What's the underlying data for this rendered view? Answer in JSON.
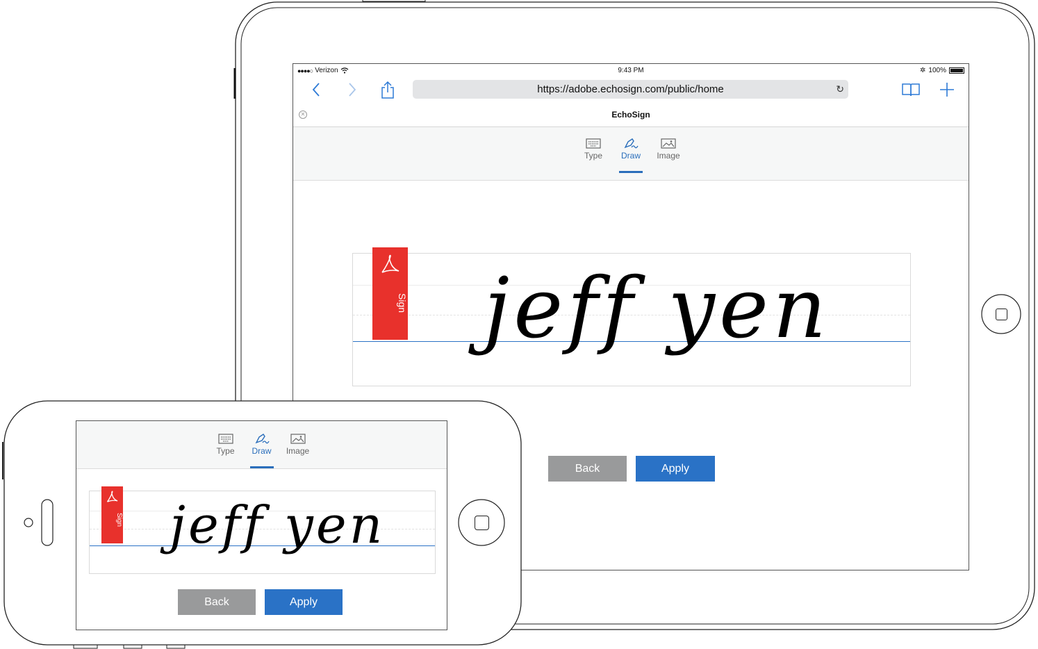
{
  "ipad": {
    "status": {
      "carrier": "Verizon",
      "time": "9:43 PM",
      "battery": "100%"
    },
    "browser": {
      "url": "https://adobe.echosign.com/public/home",
      "tab_title": "EchoSign"
    },
    "modes": [
      {
        "label": "Type",
        "icon": "keyboard-icon"
      },
      {
        "label": "Draw",
        "icon": "pen-icon",
        "active": true
      },
      {
        "label": "Image",
        "icon": "image-icon"
      }
    ],
    "signature": {
      "text": "jeff yen",
      "bookmark_label": "Sign"
    },
    "buttons": {
      "back": "Back",
      "apply": "Apply"
    }
  },
  "iphone": {
    "modes": [
      {
        "label": "Type",
        "icon": "keyboard-icon"
      },
      {
        "label": "Draw",
        "icon": "pen-icon",
        "active": true
      },
      {
        "label": "Image",
        "icon": "image-icon"
      }
    ],
    "signature": {
      "text": "jeff yen",
      "bookmark_label": "Sign"
    },
    "buttons": {
      "back": "Back",
      "apply": "Apply"
    }
  },
  "colors": {
    "accent": "#2a72c6",
    "active_tab": "#2a6ebb",
    "back_button": "#999a9b",
    "bookmark": "#e8312c"
  }
}
